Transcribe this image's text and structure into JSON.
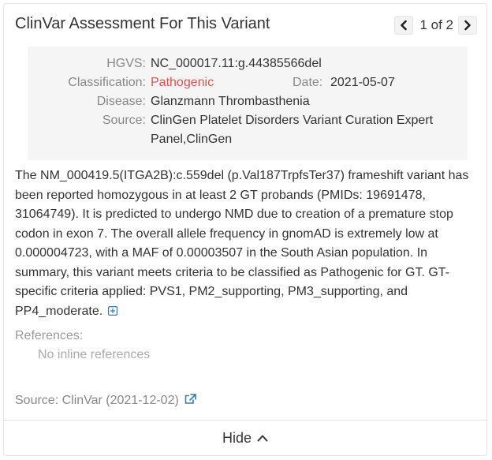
{
  "header": {
    "title": "ClinVar Assessment For This Variant",
    "pager_text": "1 of 2"
  },
  "details": {
    "hgvs_label": "HGVS:",
    "hgvs_value": "NC_000017.11:g.44385566del",
    "classification_label": "Classification:",
    "classification_value": "Pathogenic",
    "date_label": "Date:",
    "date_value": "2021-05-07",
    "disease_label": "Disease:",
    "disease_value": "Glanzmann Thrombasthenia",
    "source_label": "Source:",
    "source_value": "ClinGen Platelet Disorders Variant Curation Expert Panel,ClinGen"
  },
  "description": "The NM_000419.5(ITGA2B):c.559del (p.Val187TrpfsTer37) frameshift variant has been reported homozygous in at least 2 GT probands (PMIDs: 19691478, 31064749). It is predicted to undergo NMD due to creation of a premature stop codon in exon 7. The overall allele frequency in gnomAD is extremely low at 0.000004723, with a MAF of 0.00003507 in the South Asian population. In summary, this variant meets criteria to be classified as Pathogenic for GT. GT-specific criteria applied: PVS1, PM2_supporting, PM3_supporting, and PP4_moderate.",
  "references": {
    "label": "References:",
    "none_text": "No inline references"
  },
  "source_line": "Source: ClinVar (2021-12-02)",
  "footer": {
    "hide_label": "Hide"
  },
  "colors": {
    "pathogenic": "#d9534f",
    "link": "#337ab7"
  },
  "icons": {
    "prev": "chevron-left-icon",
    "next": "chevron-right-icon",
    "expand": "plus-square-icon",
    "external": "external-link-icon",
    "collapse": "chevron-up-icon"
  }
}
